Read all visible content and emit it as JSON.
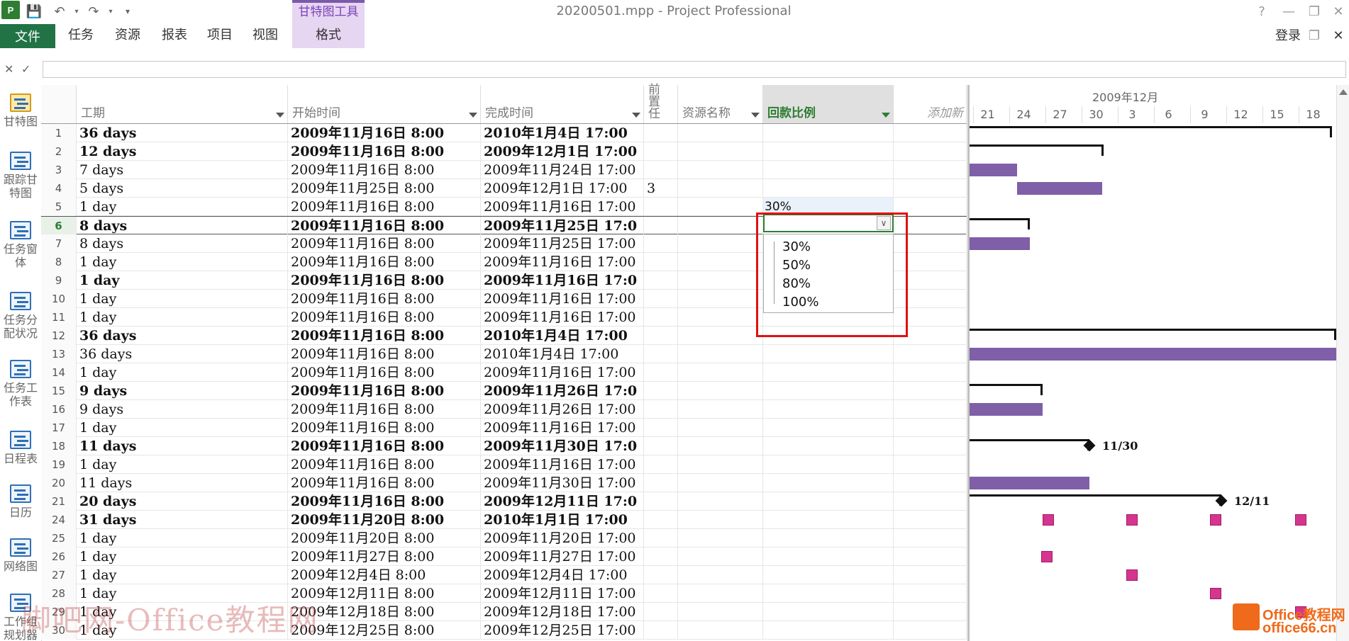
{
  "app": {
    "icon_text": "P",
    "window_title": "20200501.mpp - Project Professional",
    "context_tab_group": "甘特图工具",
    "login": "登录",
    "help_icon": "?"
  },
  "ribbon_tabs": [
    {
      "label": "文件"
    },
    {
      "label": "任务"
    },
    {
      "label": "资源"
    },
    {
      "label": "报表"
    },
    {
      "label": "项目"
    },
    {
      "label": "视图"
    },
    {
      "label": "格式"
    }
  ],
  "views": [
    {
      "label": "甘特图",
      "icon": "gantt-chart-icon"
    },
    {
      "label": "跟踪甘特图",
      "icon": "tracking-gantt-icon"
    },
    {
      "label": "任务窗体",
      "icon": "task-form-icon"
    },
    {
      "label": "任务分配状况",
      "icon": "task-usage-icon"
    },
    {
      "label": "任务工作表",
      "icon": "task-sheet-icon"
    },
    {
      "label": "日程表",
      "icon": "timeline-icon"
    },
    {
      "label": "日历",
      "icon": "calendar-icon"
    },
    {
      "label": "网络图",
      "icon": "network-diagram-icon"
    },
    {
      "label": "工作组规划器",
      "icon": "team-planner-icon"
    }
  ],
  "columns": {
    "duration": "工期",
    "start": "开始时间",
    "finish": "完成时间",
    "predecessors": "前置任",
    "resource": "资源名称",
    "rate": "回款比例",
    "add": "添加新"
  },
  "rows": [
    {
      "id": "1",
      "dur": "36 days",
      "start": "2009年11月16日 8:00",
      "finish": "2010年1月4日 17:00",
      "pred": "",
      "rate": "",
      "bold": true
    },
    {
      "id": "2",
      "dur": "12 days",
      "start": "2009年11月16日 8:00",
      "finish": "2009年12月1日 17:00",
      "pred": "",
      "rate": "",
      "bold": true
    },
    {
      "id": "3",
      "dur": "7 days",
      "start": "2009年11月16日 8:00",
      "finish": "2009年11月24日 17:00",
      "pred": "",
      "rate": "",
      "bold": false
    },
    {
      "id": "4",
      "dur": "5 days",
      "start": "2009年11月25日 8:00",
      "finish": "2009年12月1日 17:00",
      "pred": "3",
      "rate": "",
      "bold": false
    },
    {
      "id": "5",
      "dur": "1 day",
      "start": "2009年11月16日 8:00",
      "finish": "2009年11月16日 17:00",
      "pred": "",
      "rate": "30%",
      "bold": false
    },
    {
      "id": "6",
      "dur": "8 days",
      "start": "2009年11月16日 8:00",
      "finish": "2009年11月25日 17:0",
      "pred": "",
      "rate": "",
      "bold": true
    },
    {
      "id": "7",
      "dur": "8 days",
      "start": "2009年11月16日 8:00",
      "finish": "2009年11月25日 17:00",
      "pred": "",
      "rate": "",
      "bold": false
    },
    {
      "id": "8",
      "dur": "1 day",
      "start": "2009年11月16日 8:00",
      "finish": "2009年11月16日 17:00",
      "pred": "",
      "rate": "",
      "bold": false
    },
    {
      "id": "9",
      "dur": "1 day",
      "start": "2009年11月16日 8:00",
      "finish": "2009年11月16日 17:0",
      "pred": "",
      "rate": "",
      "bold": true
    },
    {
      "id": "10",
      "dur": "1 day",
      "start": "2009年11月16日 8:00",
      "finish": "2009年11月16日 17:00",
      "pred": "",
      "rate": "",
      "bold": false
    },
    {
      "id": "11",
      "dur": "1 day",
      "start": "2009年11月16日 8:00",
      "finish": "2009年11月16日 17:00",
      "pred": "",
      "rate": "",
      "bold": false
    },
    {
      "id": "12",
      "dur": "36 days",
      "start": "2009年11月16日 8:00",
      "finish": "2010年1月4日 17:00",
      "pred": "",
      "rate": "",
      "bold": true
    },
    {
      "id": "13",
      "dur": "36 days",
      "start": "2009年11月16日 8:00",
      "finish": "2010年1月4日 17:00",
      "pred": "",
      "rate": "",
      "bold": false
    },
    {
      "id": "14",
      "dur": "1 day",
      "start": "2009年11月16日 8:00",
      "finish": "2009年11月16日 17:00",
      "pred": "",
      "rate": "",
      "bold": false
    },
    {
      "id": "15",
      "dur": "9 days",
      "start": "2009年11月16日 8:00",
      "finish": "2009年11月26日 17:0",
      "pred": "",
      "rate": "",
      "bold": true
    },
    {
      "id": "16",
      "dur": "9 days",
      "start": "2009年11月16日 8:00",
      "finish": "2009年11月26日 17:00",
      "pred": "",
      "rate": "",
      "bold": false
    },
    {
      "id": "17",
      "dur": "1 day",
      "start": "2009年11月16日 8:00",
      "finish": "2009年11月16日 17:00",
      "pred": "",
      "rate": "",
      "bold": false
    },
    {
      "id": "18",
      "dur": "11 days",
      "start": "2009年11月16日 8:00",
      "finish": "2009年11月30日 17:0",
      "pred": "",
      "rate": "",
      "bold": true
    },
    {
      "id": "19",
      "dur": "1 day",
      "start": "2009年11月16日 8:00",
      "finish": "2009年11月16日 17:00",
      "pred": "",
      "rate": "",
      "bold": false
    },
    {
      "id": "20",
      "dur": "11 days",
      "start": "2009年11月16日 8:00",
      "finish": "2009年11月30日 17:00",
      "pred": "",
      "rate": "",
      "bold": false
    },
    {
      "id": "21",
      "dur": "20 days",
      "start": "2009年11月16日 8:00",
      "finish": "2009年12月11日 17:0",
      "pred": "",
      "rate": "",
      "bold": true
    },
    {
      "id": "24",
      "dur": "31 days",
      "start": "2009年11月20日 8:00",
      "finish": "2010年1月1日 17:00",
      "pred": "",
      "rate": "",
      "bold": true
    },
    {
      "id": "25",
      "dur": "1 day",
      "start": "2009年11月20日 8:00",
      "finish": "2009年11月20日 17:00",
      "pred": "",
      "rate": "",
      "bold": false
    },
    {
      "id": "26",
      "dur": "1 day",
      "start": "2009年11月27日 8:00",
      "finish": "2009年11月27日 17:00",
      "pred": "",
      "rate": "",
      "bold": false
    },
    {
      "id": "27",
      "dur": "1 day",
      "start": "2009年12月4日 8:00",
      "finish": "2009年12月4日 17:00",
      "pred": "",
      "rate": "",
      "bold": false
    },
    {
      "id": "28",
      "dur": "1 day",
      "start": "2009年12月11日 8:00",
      "finish": "2009年12月11日 17:00",
      "pred": "",
      "rate": "",
      "bold": false
    },
    {
      "id": "29",
      "dur": "1 day",
      "start": "2009年12月18日 8:00",
      "finish": "2009年12月18日 17:00",
      "pred": "",
      "rate": "",
      "bold": false
    },
    {
      "id": "30",
      "dur": "1 day",
      "start": "2009年12月25日 8:00",
      "finish": "2009年12月25日 17:00",
      "pred": "",
      "rate": "",
      "bold": false
    }
  ],
  "selected_row": "6",
  "dropdown_options": [
    "30%",
    "50%",
    "80%",
    "100%"
  ],
  "gantt": {
    "month_label": "2009年12月",
    "ticks": [
      "21",
      "24",
      "27",
      "30",
      "3",
      "6",
      "9",
      "12",
      "15",
      "18"
    ],
    "milestone_labels": [
      "11/30",
      "12/11"
    ],
    "bar_color": "#7e5fa8",
    "recurring_color": "#d6358f"
  },
  "watermark": "脚吧网-Office教程网",
  "site_logo": {
    "line1": "Office教程网",
    "line2": "office66.cn"
  }
}
